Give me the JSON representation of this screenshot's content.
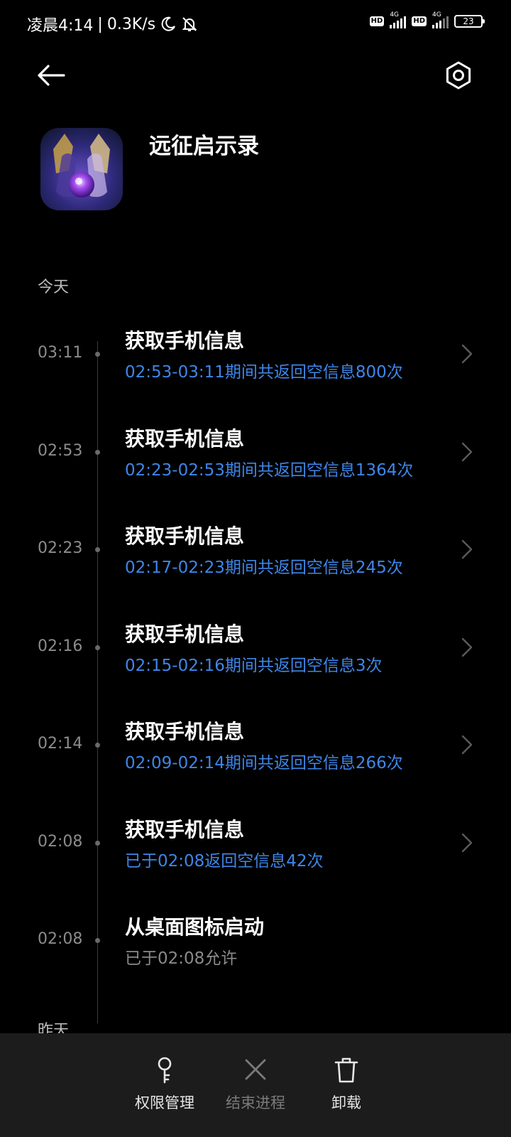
{
  "status_bar": {
    "time": "凌晨4:14",
    "separator": "|",
    "network_speed": "0.3K/s",
    "hd_badge": "HD",
    "signal_label": "4G",
    "battery": "23",
    "icons": [
      "moon-icon",
      "bell-off-icon",
      "hd-icon",
      "signal-4g-icon",
      "hd-icon",
      "signal-4g-icon",
      "battery-icon"
    ]
  },
  "nav": {
    "back_icon": "arrow-left-icon",
    "settings_icon": "settings-hexagon-icon"
  },
  "app": {
    "name": "远征启示录"
  },
  "sections": {
    "today": "今天",
    "yesterday": "昨天"
  },
  "timeline": [
    {
      "time": "03:11",
      "title": "获取手机信息",
      "detail": "02:53-03:11期间共返回空信息800次",
      "has_chevron": true
    },
    {
      "time": "02:53",
      "title": "获取手机信息",
      "detail": "02:23-02:53期间共返回空信息1364次",
      "has_chevron": true
    },
    {
      "time": "02:23",
      "title": "获取手机信息",
      "detail": "02:17-02:23期间共返回空信息245次",
      "has_chevron": true
    },
    {
      "time": "02:16",
      "title": "获取手机信息",
      "detail": "02:15-02:16期间共返回空信息3次",
      "has_chevron": true
    },
    {
      "time": "02:14",
      "title": "获取手机信息",
      "detail": "02:09-02:14期间共返回空信息266次",
      "has_chevron": true
    },
    {
      "time": "02:08",
      "title": "获取手机信息",
      "detail": "已于02:08返回空信息42次",
      "has_chevron": true
    },
    {
      "time": "02:08",
      "title": "从桌面图标启动",
      "detail": "已于02:08允许",
      "has_chevron": false
    }
  ],
  "bottom_bar": {
    "permissions": "权限管理",
    "force_stop": "结束进程",
    "uninstall": "卸载"
  },
  "colors": {
    "background": "#000000",
    "accent_blue": "#3f86e8",
    "bottom_bar": "#1c1c1c"
  }
}
